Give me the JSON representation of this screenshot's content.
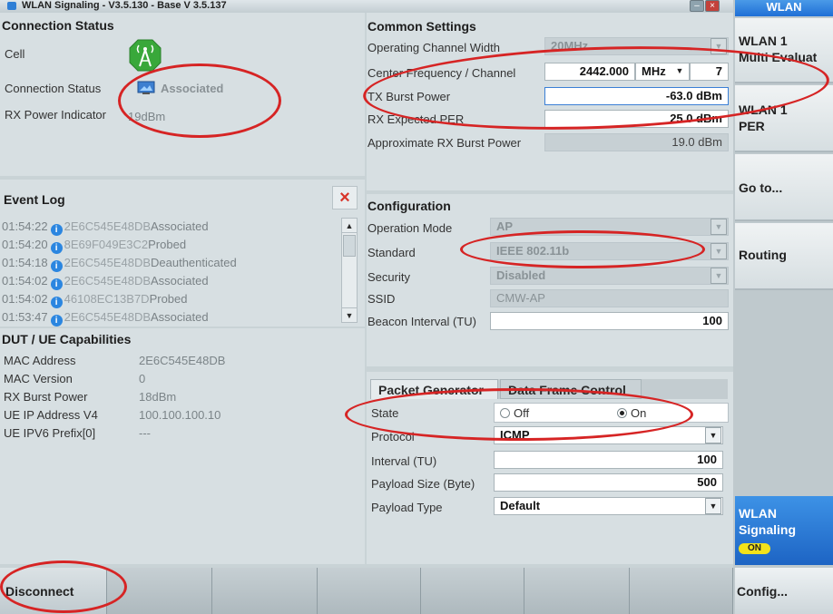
{
  "window": {
    "title": "WLAN Signaling  - V3.5.130 - Base V 3.5.137",
    "min_glyph": "–",
    "close_glyph": "×"
  },
  "connection_status": {
    "header": "Connection Status",
    "cell_label": "Cell",
    "status_label": "Connection Status",
    "status_value": "Associated",
    "rx_label": "RX Power Indicator",
    "rx_value": "19dBm"
  },
  "event_log": {
    "header": "Event Log",
    "close_glyph": "×",
    "entries": [
      {
        "time": "01:54:22",
        "id": "2E6C545E48DB",
        "event": "Associated"
      },
      {
        "time": "01:54:20",
        "id": "8E69F049E3C2",
        "event": "Probed"
      },
      {
        "time": "01:54:18",
        "id": "2E6C545E48DB",
        "event": "Deauthenticated"
      },
      {
        "time": "01:54:02",
        "id": "2E6C545E48DB",
        "event": "Associated"
      },
      {
        "time": "01:54:02",
        "id": "46108EC13B7D",
        "event": "Probed"
      },
      {
        "time": "01:53:47",
        "id": "2E6C545E48DB",
        "event": "Associated"
      }
    ]
  },
  "dut": {
    "header": "DUT / UE Capabilities",
    "rows": [
      {
        "label": "MAC Address",
        "value": "2E6C545E48DB"
      },
      {
        "label": "MAC Version",
        "value": "0"
      },
      {
        "label": "RX Burst Power",
        "value": "18dBm"
      },
      {
        "label": "UE IP Address V4",
        "value": "100.100.100.10"
      },
      {
        "label": "UE IPV6 Prefix[0]",
        "value": "---"
      }
    ]
  },
  "common_settings": {
    "header": "Common Settings",
    "channel_width_label": "Operating Channel Width",
    "channel_width_value": "20MHz",
    "center_freq_label": "Center Frequency / Channel",
    "center_freq_value": "2442.000",
    "center_freq_unit": "MHz",
    "channel_value": "7",
    "tx_burst_label": "TX Burst Power",
    "tx_burst_value": "-63.0  dBm",
    "rx_per_label": "RX Expected PER",
    "rx_per_value": "25.0  dBm",
    "approx_rx_label": "Approximate RX Burst Power",
    "approx_rx_value": "19.0  dBm"
  },
  "configuration": {
    "header": "Configuration",
    "op_mode_label": "Operation Mode",
    "op_mode_value": "AP",
    "standard_label": "Standard",
    "standard_value": "IEEE 802.11b",
    "security_label": "Security",
    "security_value": "Disabled",
    "ssid_label": "SSID",
    "ssid_value": "CMW-AP",
    "beacon_label": "Beacon Interval (TU)",
    "beacon_value": "100"
  },
  "packet_generator": {
    "tab_active": "Packet Generator",
    "tab_other": "Data Frame Control",
    "state_label": "State",
    "state_off": "Off",
    "state_on": "On",
    "protocol_label": "Protocol",
    "protocol_value": "ICMP",
    "interval_label": "Interval (TU)",
    "interval_value": "100",
    "payload_size_label": "Payload Size (Byte)",
    "payload_size_value": "500",
    "payload_type_label": "Payload Type",
    "payload_type_value": "Default"
  },
  "sidebar": {
    "title": "WLAN",
    "items": [
      {
        "line1": "WLAN 1",
        "line2": "Multi Evaluat"
      },
      {
        "line1": "WLAN 1",
        "line2": "PER"
      },
      {
        "line1": "Go to..."
      },
      {
        "line1": "Routing"
      }
    ],
    "signaling_line1": "WLAN",
    "signaling_line2": "Signaling",
    "signaling_badge": "ON",
    "config_label": "Config..."
  },
  "bottom": {
    "disconnect_label": "Disconnect"
  },
  "colors": {
    "accent_blue": "#1f6fd6",
    "annotation_red": "#d62424",
    "badge_yellow": "#f3e21a"
  }
}
